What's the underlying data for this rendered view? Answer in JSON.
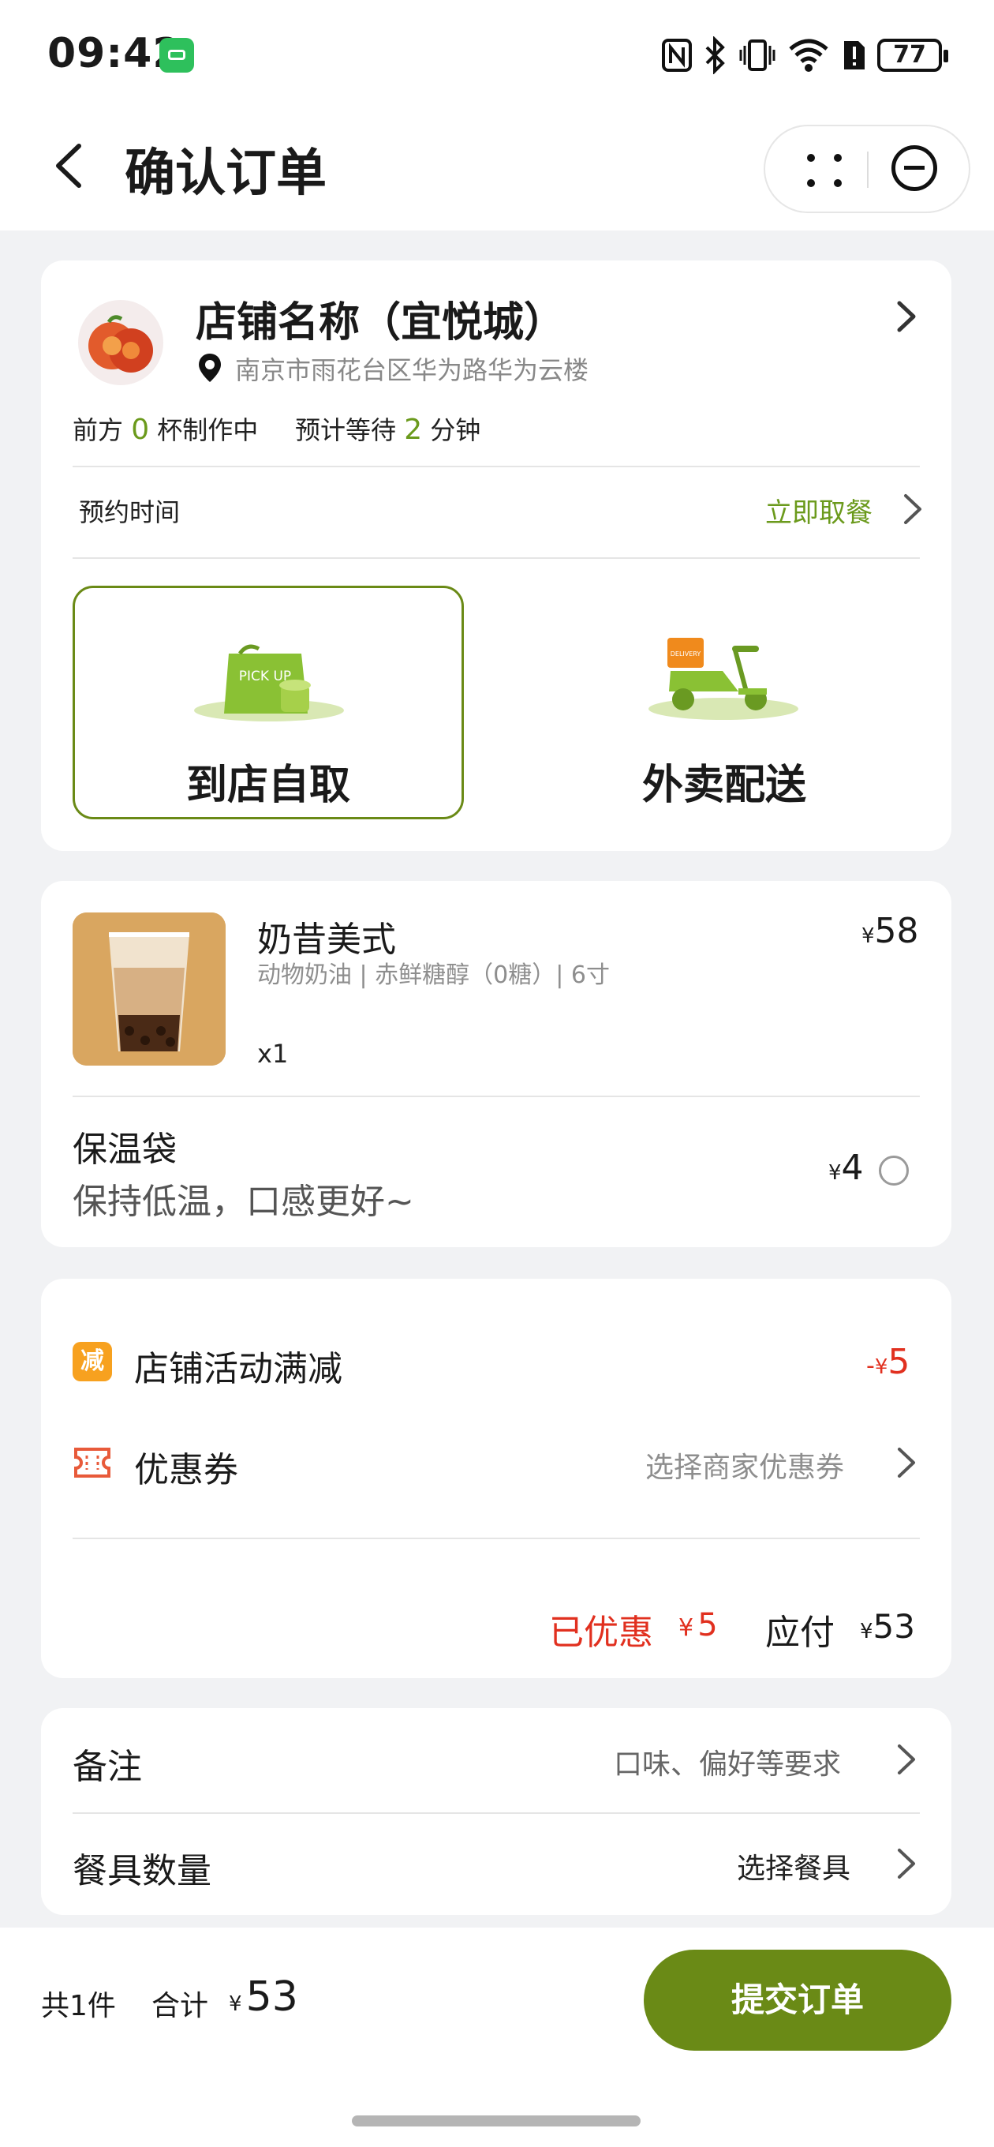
{
  "status": {
    "time": "09:42",
    "battery": "77"
  },
  "header": {
    "title": "确认订单"
  },
  "store": {
    "name": "店铺名称（宜悦城）",
    "address": "南京市雨花台区华为路华为云楼",
    "queue_prefix": "前方",
    "queue_count": "0",
    "queue_suffix": "杯制作中",
    "wait_prefix": "预计等待",
    "wait_minutes": "2",
    "wait_suffix": "分钟",
    "reserve_label": "预约时间",
    "reserve_value": "立即取餐"
  },
  "delivery": {
    "pickup_label": "到店自取",
    "pickup_art_text": "PICK UP",
    "delivery_label": "外卖配送",
    "delivery_art_text": "DELIVERY",
    "selected": "pickup"
  },
  "product": {
    "name": "奶昔美式",
    "specs": "动物奶油 | 赤鲜糖醇（0糖）| 6寸",
    "qty": "x1",
    "currency": "¥",
    "price": "58"
  },
  "addon": {
    "name": "保温袋",
    "desc": "保持低温，口感更好~",
    "currency": "¥",
    "price": "4",
    "checked": false
  },
  "discounts": {
    "promo_badge": "减",
    "promo_label": "店铺活动满减",
    "promo_prefix": "-",
    "promo_currency": "¥",
    "promo_value": "5",
    "coupon_label": "优惠券",
    "coupon_placeholder": "选择商家优惠券",
    "saved_label": "已优惠",
    "saved_currency": "¥",
    "saved_value": "5",
    "payable_label": "应付",
    "payable_currency": "¥",
    "payable_value": "53"
  },
  "extras": {
    "note_label": "备注",
    "note_placeholder": "口味、偏好等要求",
    "cutlery_label": "餐具数量",
    "cutlery_value": "选择餐具"
  },
  "footer": {
    "count": "共1件",
    "total_label": "合计",
    "currency": "¥",
    "total": "53",
    "submit": "提交订单"
  },
  "colors": {
    "accent": "#6a8a16",
    "accent_text": "#6b9a1c",
    "discount": "#e1301f",
    "badge": "#f7a11f"
  }
}
